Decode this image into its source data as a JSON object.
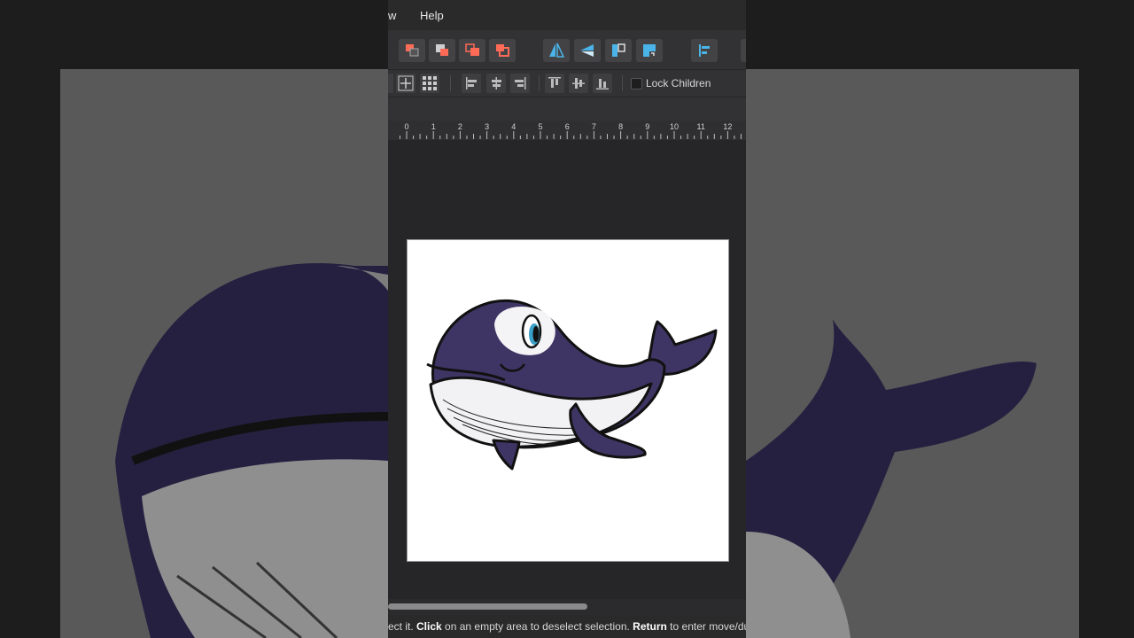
{
  "menu": {
    "partial_item": "w",
    "help": "Help"
  },
  "toolbar": {
    "icons": [
      "move-to-back-icon",
      "back-one-icon",
      "forward-one-icon",
      "move-to-front-icon",
      "flip-horizontal-icon",
      "flip-vertical-icon",
      "rotate-left-icon",
      "rotate-right-icon",
      "align-left-icon"
    ],
    "accent_red": "#ff6b57",
    "accent_blue": "#4ab4e8"
  },
  "context_toolbar": {
    "lock_children_label": "Lock Children",
    "lock_children_checked": false
  },
  "ruler": {
    "ticks": [
      "0",
      "1",
      "2",
      "3",
      "4",
      "5",
      "6",
      "7",
      "8",
      "9",
      "10",
      "11",
      "12"
    ]
  },
  "canvas": {
    "artwork": "whale-illustration",
    "whale_color": "#3f3564"
  },
  "status": {
    "part1": "ect it. ",
    "bold1": "Click",
    "part2": " on an empty area to deselect selection. ",
    "bold2": "Return",
    "part3": " to enter move/du"
  }
}
